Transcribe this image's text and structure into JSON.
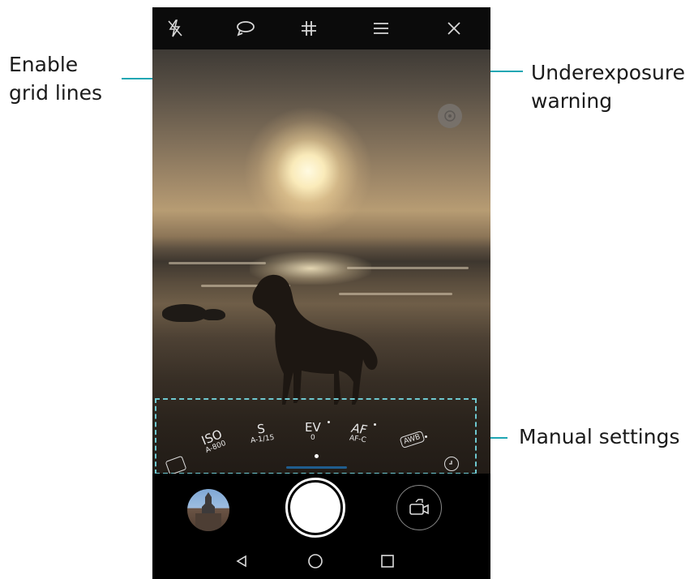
{
  "annotations": {
    "grid_lines": [
      "Enable",
      "grid lines"
    ],
    "underexposure": [
      "Underexposure",
      "warning"
    ],
    "manual_settings": "Manual settings"
  },
  "toolbar": {
    "icons": [
      "flash-off-icon",
      "rotate-icon",
      "grid-icon",
      "menu-icon",
      "close-icon"
    ]
  },
  "manual_settings": {
    "iso": {
      "label": "ISO",
      "value": "A-800"
    },
    "shutter": {
      "label": "S",
      "value": "A-1/15"
    },
    "ev": {
      "label": "EV",
      "value": "0"
    },
    "af": {
      "label": "AF",
      "value": "AF-C"
    },
    "awb": {
      "label": "AWB"
    }
  },
  "colors": {
    "annotation_line": "#1fa6b3",
    "dashed_box": "#6ec8d0"
  }
}
